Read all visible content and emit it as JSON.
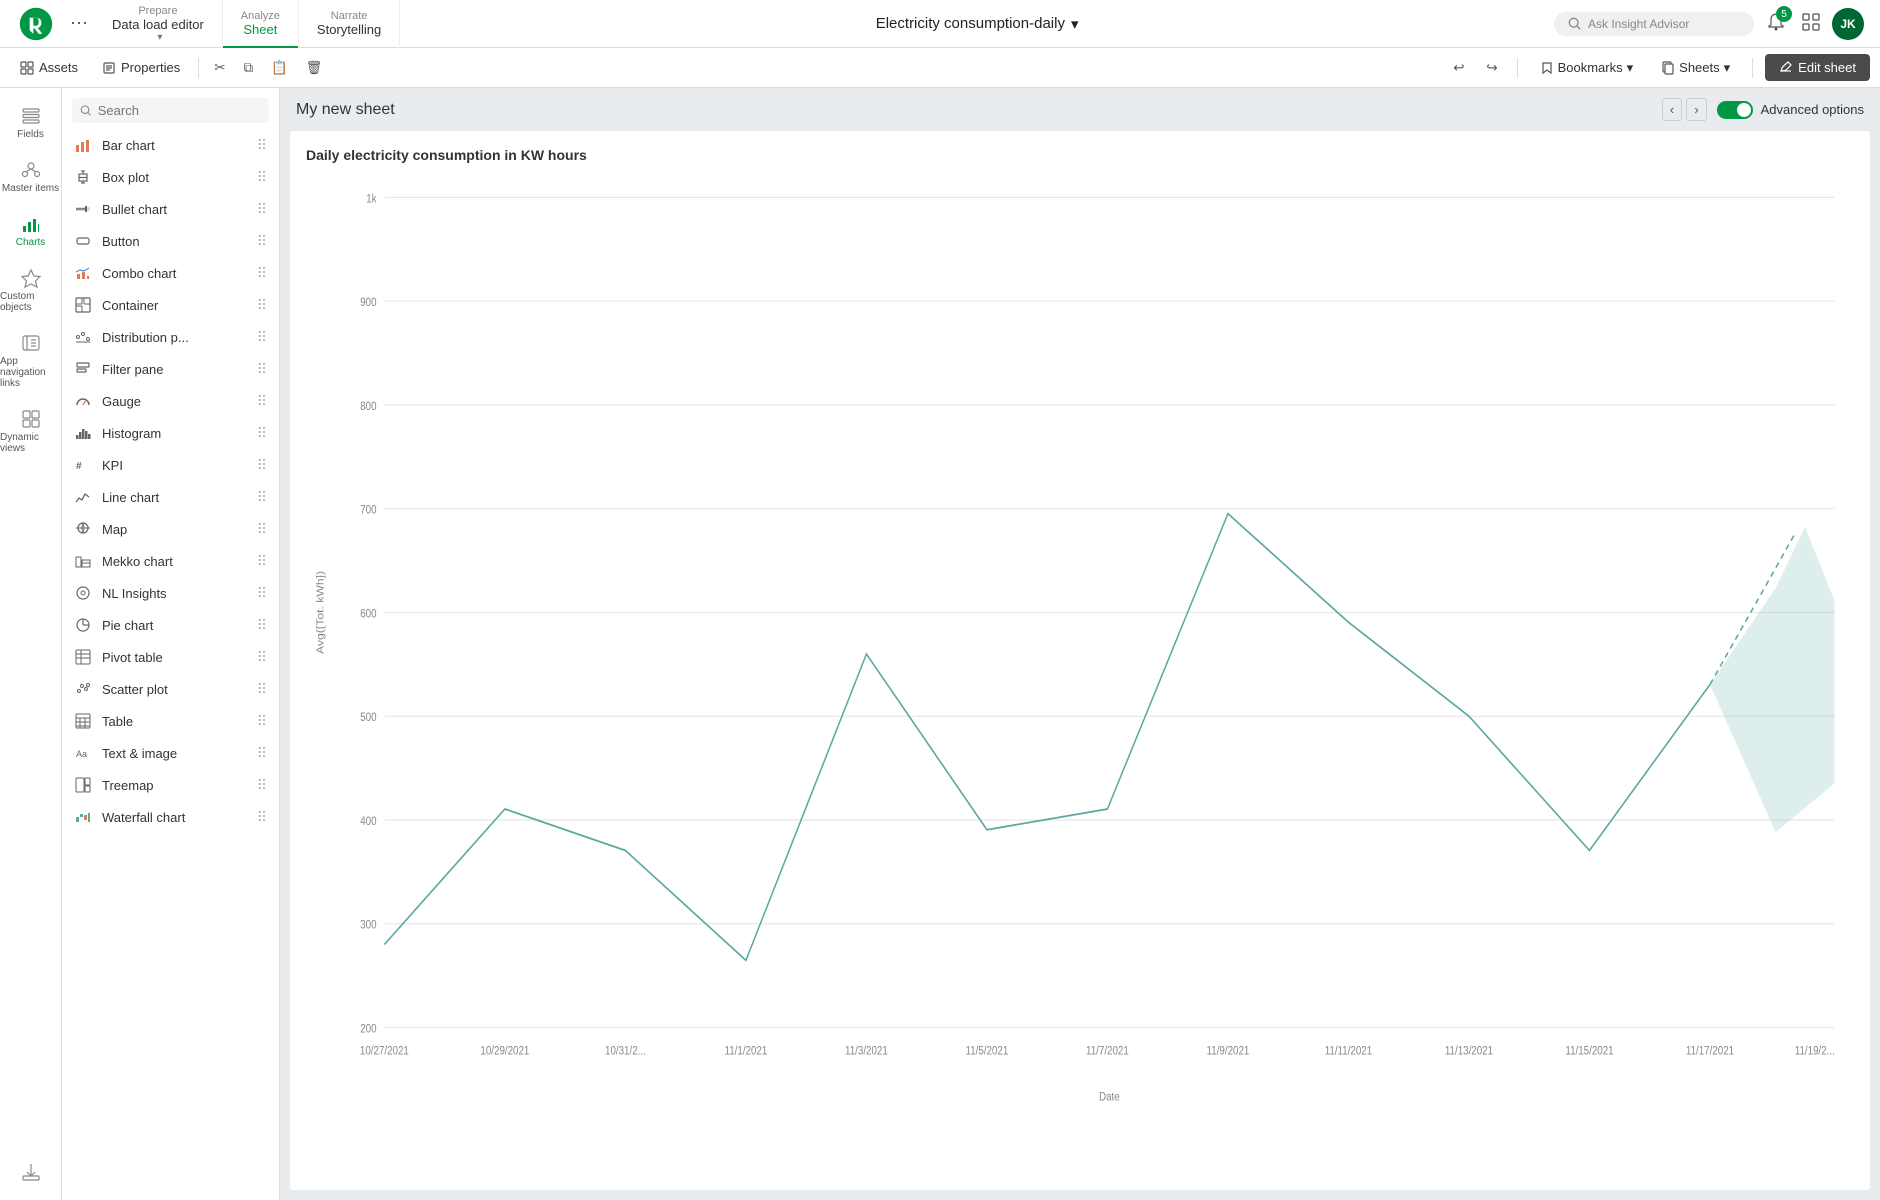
{
  "topNav": {
    "logo_alt": "Qlik",
    "prepare_label": "Prepare",
    "prepare_sub": "Data load editor",
    "analyze_label": "Analyze",
    "analyze_sub": "Sheet",
    "narrate_label": "Narrate",
    "narrate_sub": "Storytelling",
    "center_title": "Electricity consumption-daily",
    "insight_placeholder": "Ask Insight Advisor",
    "notif_count": "5",
    "avatar_text": "JK"
  },
  "toolbar": {
    "assets_label": "Assets",
    "properties_label": "Properties",
    "undo_label": "Undo",
    "redo_label": "Redo",
    "bookmarks_label": "Bookmarks",
    "sheets_label": "Sheets",
    "edit_sheet_label": "Edit sheet"
  },
  "sidebar": {
    "items": [
      {
        "id": "fields",
        "label": "Fields"
      },
      {
        "id": "master-items",
        "label": "Master items"
      },
      {
        "id": "charts",
        "label": "Charts"
      },
      {
        "id": "custom-objects",
        "label": "Custom objects"
      },
      {
        "id": "app-nav",
        "label": "App navigation links"
      },
      {
        "id": "dynamic-views",
        "label": "Dynamic views"
      }
    ]
  },
  "chartPanel": {
    "search_placeholder": "Search",
    "items": [
      {
        "id": "bar-chart",
        "label": "Bar chart",
        "icon": "bar"
      },
      {
        "id": "box-plot",
        "label": "Box plot",
        "icon": "box"
      },
      {
        "id": "bullet-chart",
        "label": "Bullet chart",
        "icon": "bullet"
      },
      {
        "id": "button",
        "label": "Button",
        "icon": "button"
      },
      {
        "id": "combo-chart",
        "label": "Combo chart",
        "icon": "combo"
      },
      {
        "id": "container",
        "label": "Container",
        "icon": "container"
      },
      {
        "id": "distribution-p",
        "label": "Distribution p...",
        "icon": "dist"
      },
      {
        "id": "filter-pane",
        "label": "Filter pane",
        "icon": "filter"
      },
      {
        "id": "gauge",
        "label": "Gauge",
        "icon": "gauge"
      },
      {
        "id": "histogram",
        "label": "Histogram",
        "icon": "histogram"
      },
      {
        "id": "kpi",
        "label": "KPI",
        "icon": "kpi"
      },
      {
        "id": "line-chart",
        "label": "Line chart",
        "icon": "line"
      },
      {
        "id": "map",
        "label": "Map",
        "icon": "map"
      },
      {
        "id": "mekko-chart",
        "label": "Mekko chart",
        "icon": "mekko"
      },
      {
        "id": "nl-insights",
        "label": "NL Insights",
        "icon": "nl"
      },
      {
        "id": "pie-chart",
        "label": "Pie chart",
        "icon": "pie"
      },
      {
        "id": "pivot-table",
        "label": "Pivot table",
        "icon": "pivot"
      },
      {
        "id": "scatter-plot",
        "label": "Scatter plot",
        "icon": "scatter"
      },
      {
        "id": "table",
        "label": "Table",
        "icon": "table"
      },
      {
        "id": "text-image",
        "label": "Text & image",
        "icon": "text"
      },
      {
        "id": "treemap",
        "label": "Treemap",
        "icon": "treemap"
      },
      {
        "id": "waterfall-chart",
        "label": "Waterfall chart",
        "icon": "waterfall"
      }
    ]
  },
  "sheet": {
    "title": "My new sheet",
    "chart_title": "Daily electricity consumption in KW hours",
    "advanced_options_label": "Advanced options",
    "x_axis_label": "Date",
    "y_axis_label": "Avg([Tot. kWh])",
    "y_values": [
      "1k",
      "900",
      "800",
      "700",
      "600",
      "500",
      "400",
      "300",
      "200"
    ],
    "x_dates": [
      "10/27/2021",
      "10/29/2021",
      "10/31/2...",
      "11/1/2021",
      "11/3/2021",
      "11/5/2021",
      "11/7/2021",
      "11/9/2021",
      "11/11/2021",
      "11/13/2021",
      "11/15/2021",
      "11/17/2021",
      "11/19/2..."
    ]
  }
}
